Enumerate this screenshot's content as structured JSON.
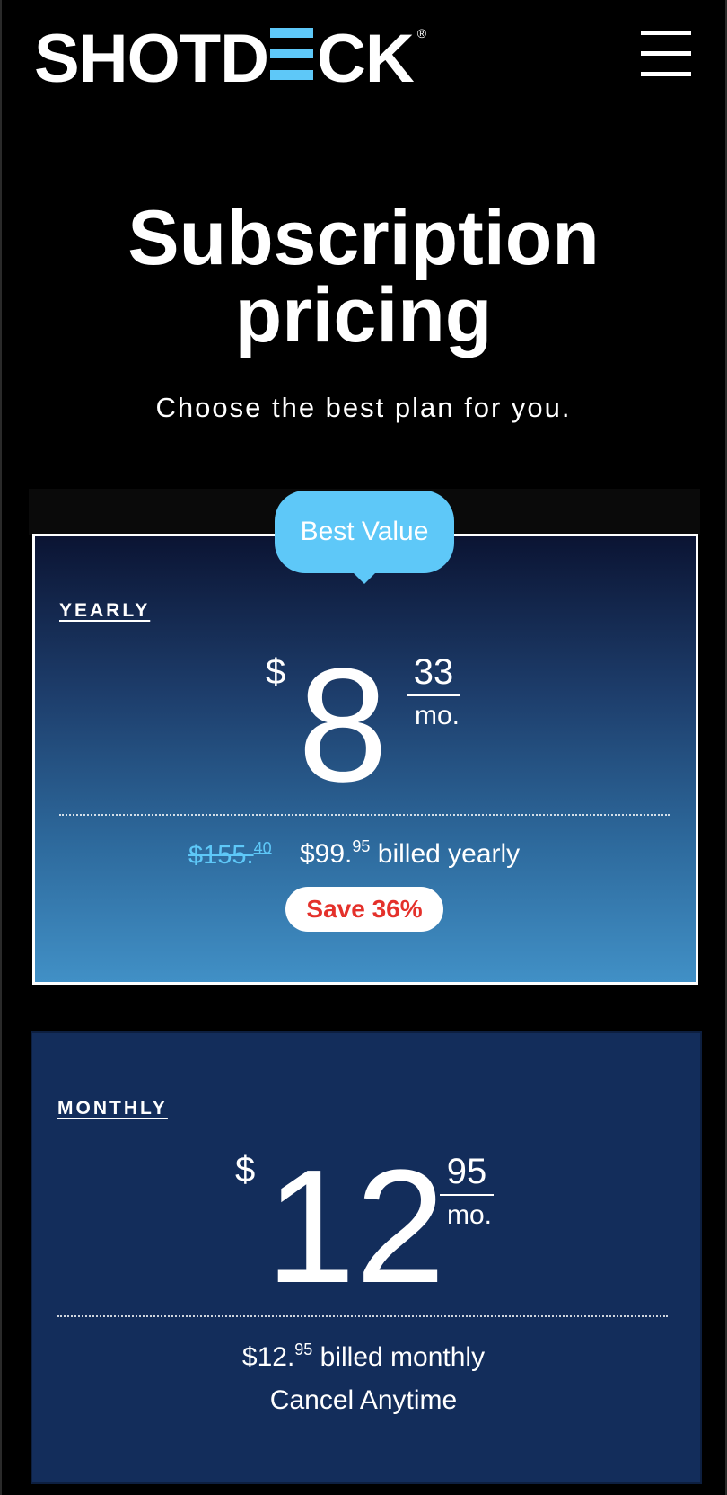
{
  "header": {
    "logo_left": "SHOTD",
    "logo_right": "CK",
    "logo_reg": "®",
    "menu_icon": "hamburger-menu-icon"
  },
  "hero": {
    "title_line1": "Subscription",
    "title_line2": "pricing",
    "subtitle": "Choose the best plan for you."
  },
  "plans": {
    "yearly": {
      "badge": "Best Value",
      "label": "YEARLY",
      "currency": "$",
      "price_main": "8",
      "price_cents": "33",
      "per": "mo.",
      "original_price": "$155.",
      "original_cents": "40",
      "billed_price": "$99.",
      "billed_cents": "95",
      "billed_text": "billed yearly",
      "save": "Save 36%"
    },
    "monthly": {
      "label": "MONTHLY",
      "currency": "$",
      "price_main": "12",
      "price_cents": "95",
      "per": "mo.",
      "billed_price": "$12.",
      "billed_cents": "95",
      "billed_text": "billed monthly",
      "cancel": "Cancel Anytime"
    }
  },
  "colors": {
    "accent": "#5ec8f8",
    "save_red": "#e4312b",
    "monthly_bg": "#132d5b"
  }
}
